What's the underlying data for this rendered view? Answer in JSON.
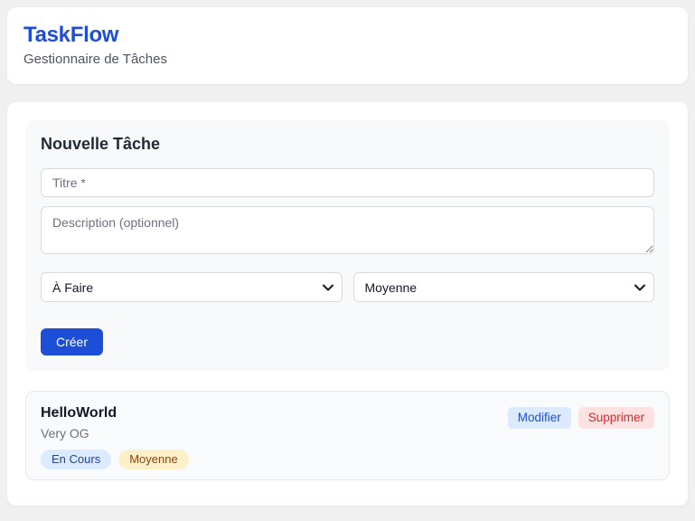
{
  "header": {
    "title": "TaskFlow",
    "subtitle": "Gestionnaire de Tâches"
  },
  "form": {
    "heading": "Nouvelle Tâche",
    "title_placeholder": "Titre *",
    "description_placeholder": "Description (optionnel)",
    "status_select": {
      "selected": "À Faire"
    },
    "priority_select": {
      "selected": "Moyenne"
    },
    "submit_label": "Créer"
  },
  "tasks": [
    {
      "title": "HelloWorld",
      "description": "Very OG",
      "status_badge": "En Cours",
      "priority_badge": "Moyenne",
      "edit_label": "Modifier",
      "delete_label": "Supprimer"
    }
  ],
  "colors": {
    "accent_blue": "#1d4ed8",
    "page_background": "#f0f0f1",
    "card_background": "#ffffff",
    "form_background": "#f8f9fa",
    "status_badge_bg": "#dbeafe",
    "status_badge_text": "#1e40af",
    "priority_badge_bg": "#fdf0c8",
    "priority_badge_text": "#92400e",
    "edit_button_bg": "#dbeafe",
    "edit_button_text": "#1d4ed8",
    "delete_button_bg": "#fee2e2",
    "delete_button_text": "#dc2626"
  }
}
